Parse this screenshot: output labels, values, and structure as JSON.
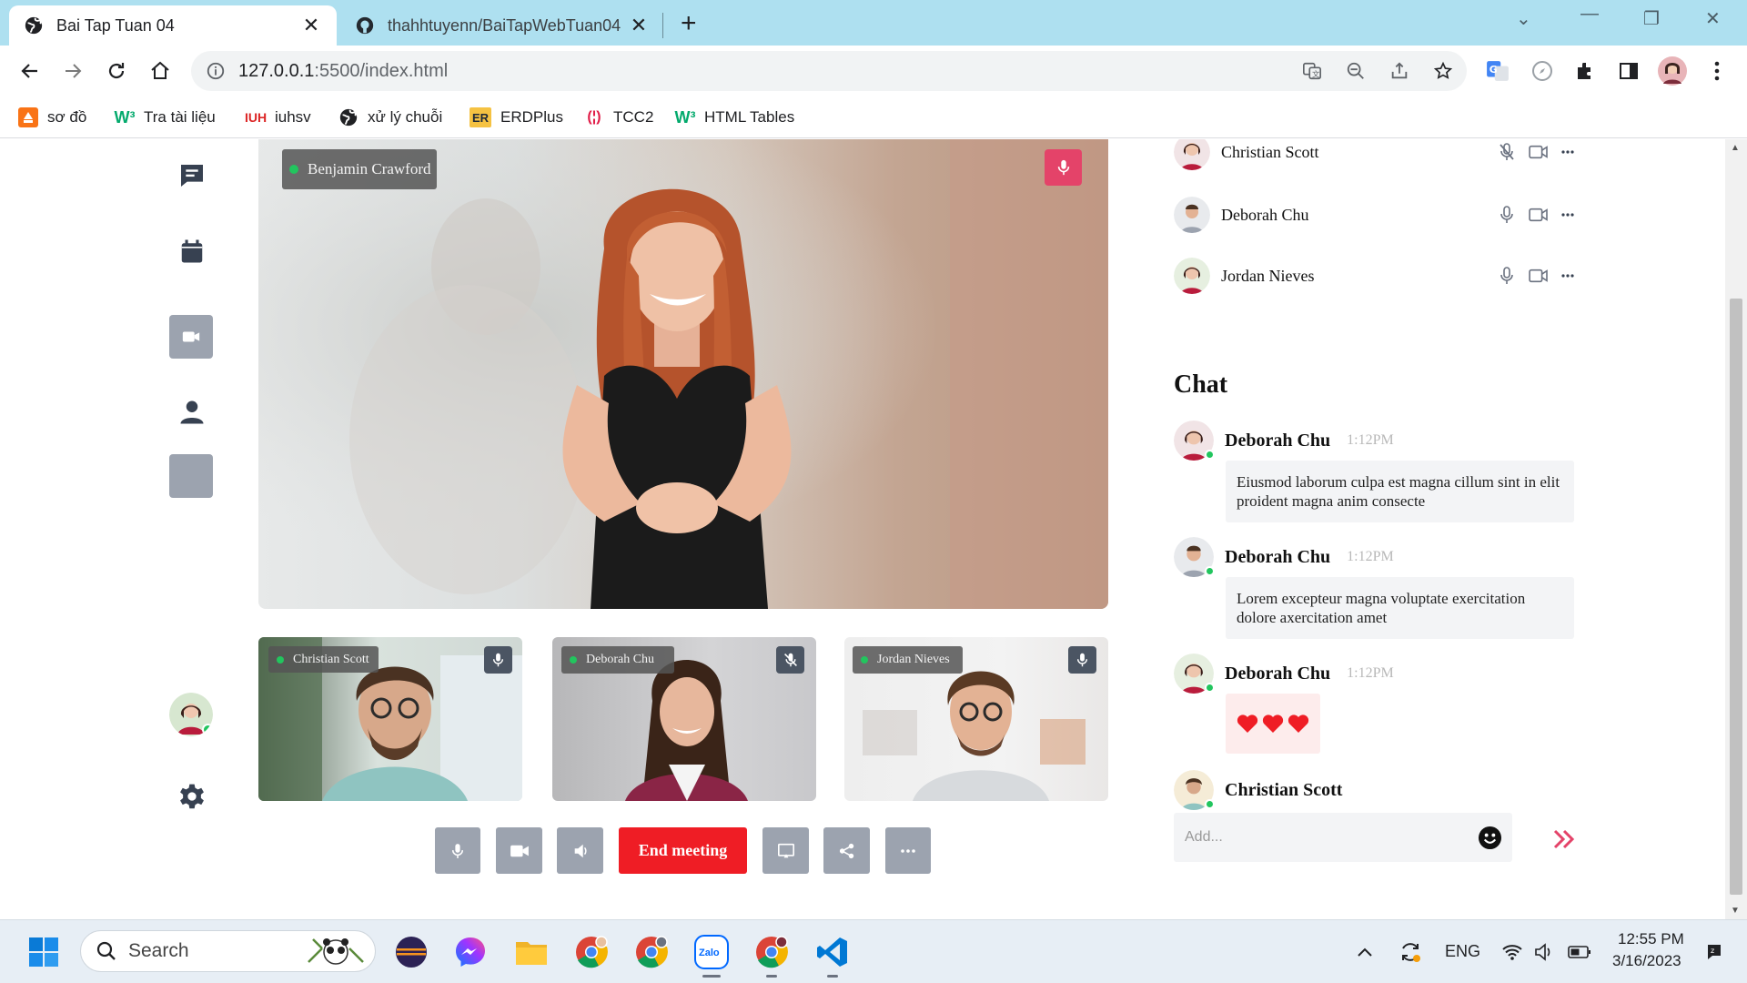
{
  "browser": {
    "tabs": [
      {
        "title": "Bai Tap Tuan 04",
        "icon": "globe-icon",
        "active": true
      },
      {
        "title": "thahhtuyenn/BaiTapWebTuan04",
        "icon": "github-icon",
        "active": false
      }
    ],
    "url_host": "127.0.0.1",
    "url_rest": ":5500/index.html",
    "bookmarks": [
      {
        "label": "sơ đồ",
        "icon": "diagram-icon",
        "color": "#f97316"
      },
      {
        "label": "Tra tài liệu",
        "icon": "w3schools-icon",
        "color": "#04aa6d"
      },
      {
        "label": "iuhsv",
        "icon": "iuh-icon",
        "color": "#dc2626"
      },
      {
        "label": "xử lý chuỗi",
        "icon": "globe-icon",
        "color": "#202124"
      },
      {
        "label": "ERDPlus",
        "icon": "erdplus-icon",
        "color": "#f5c242",
        "badge": "ER"
      },
      {
        "label": "TCC2",
        "icon": "tcc-icon",
        "color": "#e11d48"
      },
      {
        "label": "HTML Tables",
        "icon": "w3schools-icon",
        "color": "#04aa6d"
      }
    ]
  },
  "meeting": {
    "main_speaker": "Benjamin Crawford",
    "thumbnails": [
      {
        "name": "Christian Scott",
        "muted": false
      },
      {
        "name": "Deborah Chu",
        "muted": true
      },
      {
        "name": "Jordan Nieves",
        "muted": false
      }
    ],
    "controls": {
      "end_label": "End meeting"
    }
  },
  "participants": [
    {
      "name": "Christian Scott",
      "muted": true
    },
    {
      "name": "Deborah Chu",
      "muted": false
    },
    {
      "name": "Jordan Nieves",
      "muted": false
    }
  ],
  "chat": {
    "title": "Chat",
    "messages": [
      {
        "name": "Deborah Chu",
        "time": "1:12PM",
        "text": "Eiusmod laborum culpa est magna cillum sint in elit proident magna anim consecte"
      },
      {
        "name": "Deborah Chu",
        "time": "1:12PM",
        "text": "Lorem excepteur magna voluptate exercitation dolore axercitation amet"
      },
      {
        "name": "Deborah Chu",
        "time": "1:12PM",
        "hearts": 3
      },
      {
        "name": "Christian Scott",
        "time": ""
      }
    ],
    "input_placeholder": "Add..."
  },
  "taskbar": {
    "search_label": "Search",
    "lang": "ENG",
    "time": "12:55 PM",
    "date": "3/16/2023"
  },
  "colors": {
    "accent_red": "#ef1d25",
    "mic_pink": "#e44369",
    "online_green": "#22c55e",
    "control_gray": "#9ca3af"
  }
}
